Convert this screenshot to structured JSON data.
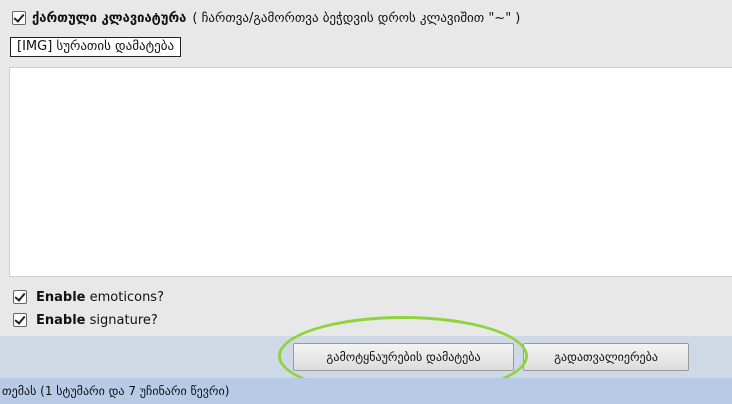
{
  "keyboard": {
    "label": "ქართული კლავიატურა",
    "hint": "( ჩართვა/გამორთვა ბეჭდვის დროს კლავიშით \"~\" )",
    "checked": true
  },
  "image_button": {
    "label": "[IMG] სურათის დამატება"
  },
  "options": [
    {
      "bold": "Enable",
      "label": "emoticons?",
      "checked": true
    },
    {
      "bold": "Enable",
      "label": "signature?",
      "checked": true
    }
  ],
  "actions": {
    "add_attachment_label": "გამოტყნაურების დამატება",
    "check_spelling_label": "გადათვალიერება"
  },
  "footer": {
    "text": "თემას (1 სტუმარი და 7 უჩინარი წევრი)"
  },
  "colors": {
    "highlight_ring": "#8fd33a",
    "actions_bar": "#cfd9e6",
    "footer_bar": "#b7cbe6"
  }
}
